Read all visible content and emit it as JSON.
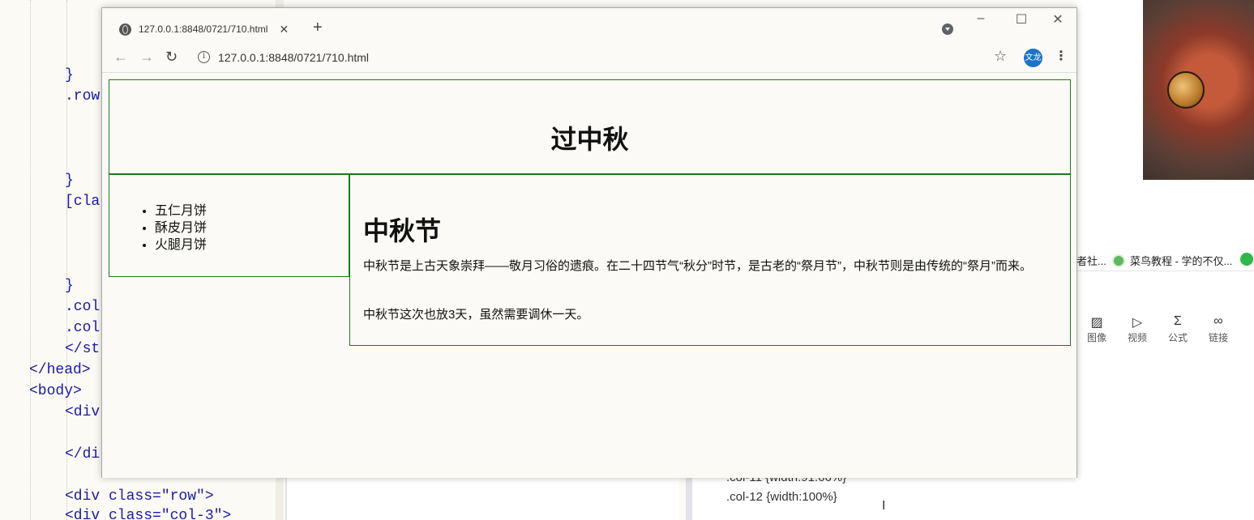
{
  "editor": {
    "lines": [
      {
        "text": "}"
      },
      {
        "text": ".row"
      },
      {
        "text": "}"
      },
      {
        "text": "[cla"
      },
      {
        "text": "}"
      },
      {
        "text": ".col"
      },
      {
        "text": ".col"
      },
      {
        "text": "</st"
      },
      {
        "text": "</head>"
      },
      {
        "text": "<body>"
      },
      {
        "text": "<div"
      },
      {
        "text": "</di"
      },
      {
        "text": "<div class=\"row\">"
      },
      {
        "text": "<div class=\"col-3\">"
      }
    ]
  },
  "background": {
    "bookmarks": [
      "者社...",
      "菜鸟教程 - 学的不仅..."
    ],
    "tools": [
      {
        "icon": "image-icon",
        "label": "图像"
      },
      {
        "icon": "video-icon",
        "label": "视频"
      },
      {
        "icon": "formula-icon",
        "label": "公式"
      },
      {
        "icon": "link-icon",
        "label": "链接"
      }
    ],
    "doc_lines": [
      ".col-11 {width:91.66%}",
      ".col-12 {width:100%}"
    ]
  },
  "browser": {
    "tab": {
      "title": "127.0.0.1:8848/0721/710.html",
      "close": "✕"
    },
    "new_tab": "+",
    "window_controls": {
      "minimize": "–",
      "maximize": "☐",
      "close": "✕"
    },
    "nav": {
      "back": "←",
      "forward": "→",
      "reload": "↻"
    },
    "address": "127.0.0.1:8848/0721/710.html",
    "star": "☆",
    "avatar": "文龙",
    "menu": "⋮"
  },
  "page": {
    "title": "过中秋",
    "side_items": [
      "五仁月饼",
      "酥皮月饼",
      "火腿月饼"
    ],
    "main_heading": "中秋节",
    "paragraphs": [
      "中秋节是上古天象崇拜——敬月习俗的遗痕。在二十四节气“秋分”时节，是古老的“祭月节”，中秋节则是由传统的“祭月”而来。",
      "中秋节这次也放3天，虽然需要调休一天。"
    ]
  }
}
